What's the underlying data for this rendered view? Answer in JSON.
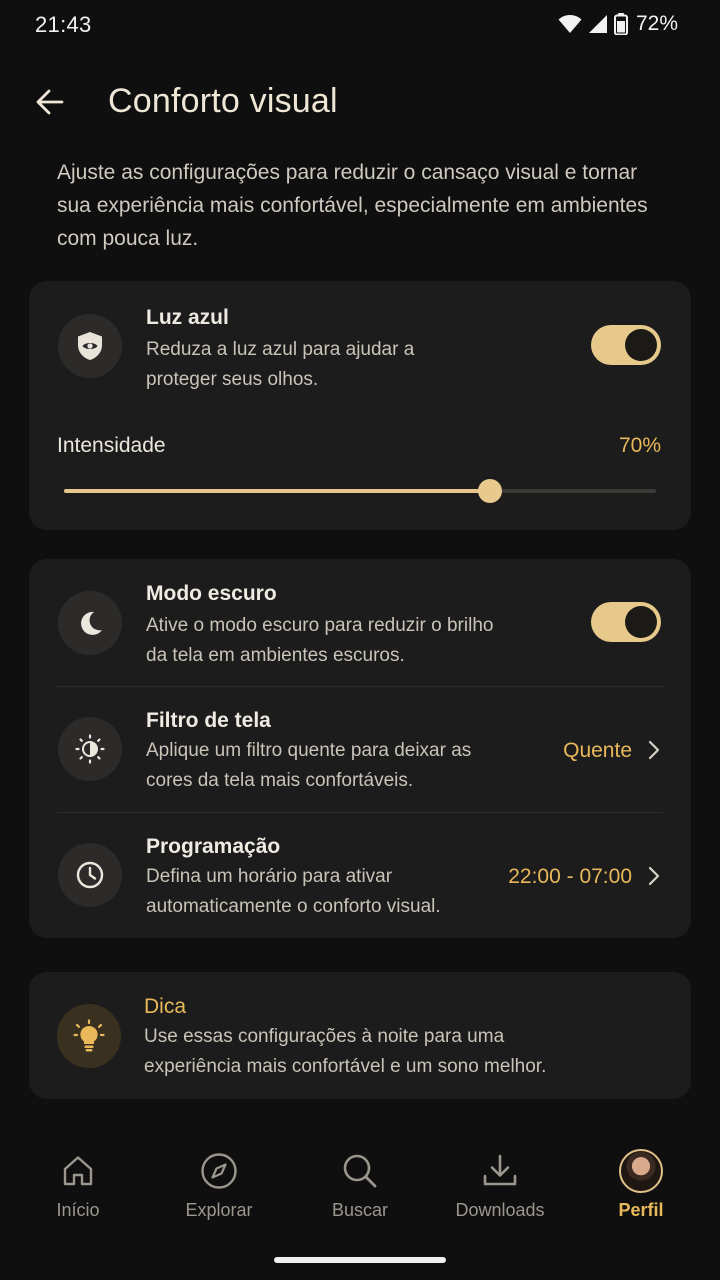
{
  "status_bar": {
    "time": "21:43",
    "battery": "72%"
  },
  "header": {
    "title": "Conforto visual"
  },
  "intro": "Ajuste as configurações para reduzir o cansaço visual e tornar sua experiência mais confortável, especialmente em ambientes com pouca luz.",
  "blue_light": {
    "title": "Luz azul",
    "description": "Reduza a luz azul para ajudar a proteger seus olhos.",
    "enabled": true,
    "intensity_label": "Intensidade",
    "intensity_value": "70%",
    "intensity_level": 0.72
  },
  "dark_mode": {
    "title": "Modo escuro",
    "description": "Ative o modo escuro para reduzir o brilho da tela em ambientes escuros.",
    "enabled": true
  },
  "screen_filter": {
    "title": "Filtro de tela",
    "description": "Aplique um filtro quente para deixar as cores da tela mais confortáveis.",
    "value": "Quente"
  },
  "schedule": {
    "title": "Programação",
    "description": "Defina um horário para ativar automaticamente o conforto visual.",
    "value": "22:00 - 07:00"
  },
  "tip": {
    "title": "Dica",
    "description": "Use essas configurações à noite para uma experiência mais confortável e um sono melhor."
  },
  "bottom_nav": {
    "items": [
      {
        "label": "Início",
        "icon": "home-icon"
      },
      {
        "label": "Explorar",
        "icon": "compass-icon"
      },
      {
        "label": "Buscar",
        "icon": "search-icon"
      },
      {
        "label": "Downloads",
        "icon": "download-icon"
      },
      {
        "label": "Perfil",
        "icon": "avatar"
      }
    ],
    "active": "Perfil"
  },
  "colors": {
    "accent": "#e9b85a",
    "toggle_on": "#e7c98b",
    "card_bg": "#1c1c1c",
    "background": "#0f0f0f"
  }
}
